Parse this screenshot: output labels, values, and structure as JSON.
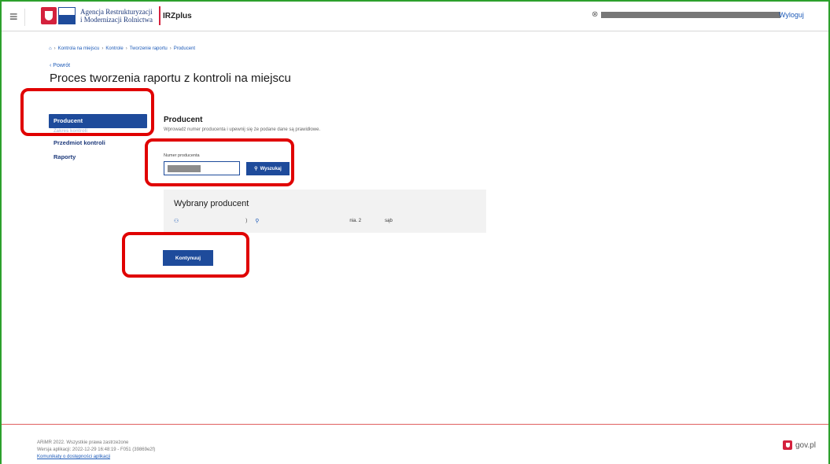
{
  "header": {
    "menu_icon": "hamburger-icon",
    "logo_line1": "Agencja Restrukturyzacji",
    "logo_line2": "i Modernizacji Rolnictwa",
    "app_name": "IRZplus",
    "user_icon": "user-icon",
    "logout_label": "Wyloguj"
  },
  "breadcrumb": {
    "home_icon": "home-icon",
    "items": [
      "Kontrola na miejscu",
      "Kontrole",
      "Tworzenie raportu",
      "Producent"
    ],
    "separator": "›"
  },
  "back_label": "Powrót",
  "page_title": "Proces tworzenia raportu z kontroli na miejscu",
  "steps": [
    {
      "label": "Producent",
      "active": true
    },
    {
      "label": "Zakres kontroli",
      "active": false
    },
    {
      "label": "Przedmiot kontroli",
      "active": false
    },
    {
      "label": "Raporty",
      "active": false
    }
  ],
  "form": {
    "section_title": "Producent",
    "section_description": "Wprowadź numer producenta i upewnij się że podane dane są prawidłowe.",
    "field_label": "Numer producenta",
    "search_button": "Wyszukaj",
    "search_icon": "search-icon"
  },
  "selected_panel": {
    "title": "Wybrany producent",
    "person_icon": "person-icon",
    "location_icon": "location-pin-icon",
    "address_fragment_1": ")",
    "address_fragment_2": "nia. 2",
    "address_fragment_3": "sąb"
  },
  "continue_button": "Kontynuuj",
  "footer": {
    "copyright": "ARiMR 2022. Wszystkie prawa zastrzeżone",
    "version": "Wersja aplikacji: 2022-12-29 16:48:19 - F051 (39869e2f)",
    "accessibility_link": "Komunikaty o dostępności aplikacji",
    "gov_label": "gov.pl"
  },
  "colors": {
    "primary": "#1e4b9b",
    "annotation": "#e00000",
    "link": "#1e5bb8"
  }
}
